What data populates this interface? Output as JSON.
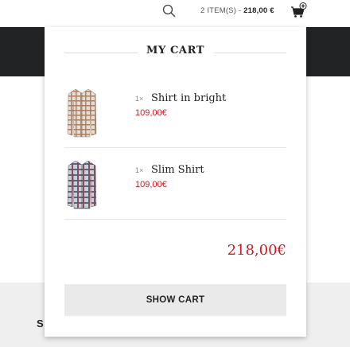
{
  "header": {
    "search_icon": "search-icon",
    "cart_summary": {
      "items_text": "2 ITEM(S)",
      "separator": " - ",
      "total": "218,00 €"
    },
    "cart_icon": "cart-icon"
  },
  "footer": {
    "partial_text": "S"
  },
  "cart": {
    "title": "MY CART",
    "items": [
      {
        "qty": "1×",
        "name": "Shirt in bright",
        "price": "109,00€"
      },
      {
        "qty": "1×",
        "name": "Slim Shirt",
        "price": "109,00€"
      }
    ],
    "total": "218,00€",
    "show_cart_label": "SHOW CART"
  },
  "colors": {
    "price_red": "#d0171f",
    "nav_dark": "#222324",
    "button_grey": "#eaeaea",
    "footer_grey": "#efefef"
  }
}
